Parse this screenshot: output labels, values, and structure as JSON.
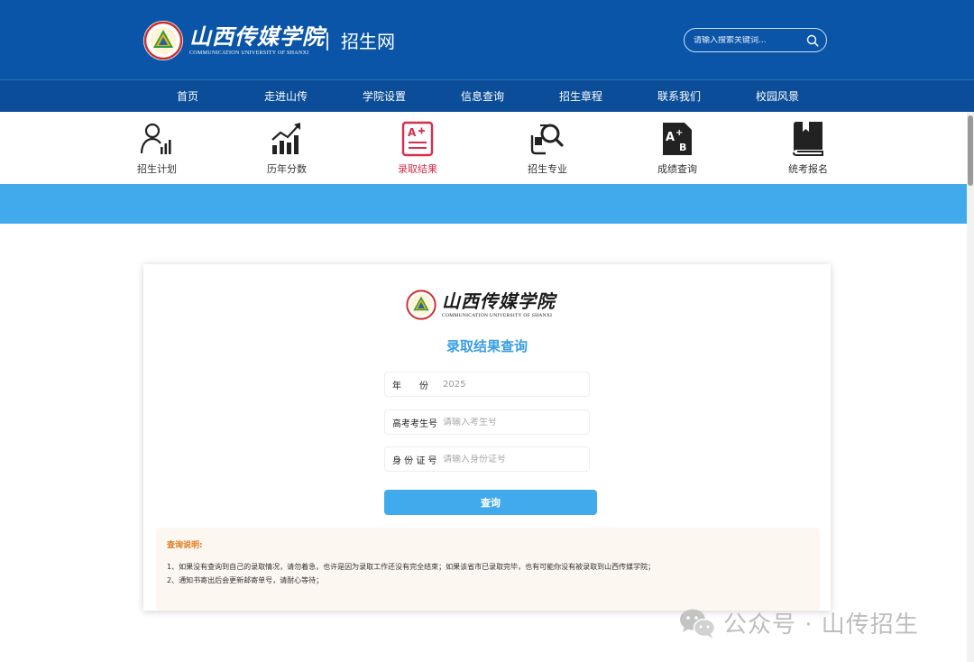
{
  "header": {
    "logo_cn": "山西传媒学院",
    "logo_en": "COMMUNICATION UNIVERSITY OF SHANXI",
    "site_name": "招生网",
    "search_placeholder": "请输入搜索关键词..."
  },
  "nav": {
    "items": [
      "首页",
      "走进山传",
      "学院设置",
      "信息查询",
      "招生章程",
      "联系我们",
      "校园风景"
    ]
  },
  "quick_links": {
    "items": [
      {
        "label": "招生计划",
        "icon": "person-chart-icon",
        "active": false
      },
      {
        "label": "历年分数",
        "icon": "trend-chart-icon",
        "active": false
      },
      {
        "label": "录取结果",
        "icon": "exam-result-icon",
        "active": true
      },
      {
        "label": "招生专业",
        "icon": "major-search-icon",
        "active": false
      },
      {
        "label": "成绩查询",
        "icon": "score-query-icon",
        "active": false
      },
      {
        "label": "统考报名",
        "icon": "book-icon",
        "active": false
      }
    ]
  },
  "card": {
    "logo_cn": "山西传媒学院",
    "logo_en": "COMMUNICATION UNIVERSITY OF SHANXI",
    "title": "录取结果查询",
    "fields": {
      "year": {
        "label": "年　　份",
        "value": "2025"
      },
      "exam_no": {
        "label": "高考考生号",
        "placeholder": "请输入考生号"
      },
      "id_no": {
        "label": "身 份 证 号",
        "placeholder": "请输入身份证号"
      }
    },
    "query_label": "查询",
    "notes": {
      "title": "查询说明:",
      "lines": [
        "1、如果没有查询到自己的录取情况，请勿着急，也许是因为录取工作还没有完全结束；如果该省市已录取完毕，也有可能你没有被录取到山西传媒学院；",
        "2、通知书寄出后会更新邮寄单号，请耐心等待；"
      ]
    }
  },
  "watermark": {
    "text": "公众号 · 山传招生"
  },
  "colors": {
    "header_blue": "#0a55a8",
    "nav_blue": "#0b4d99",
    "banner_blue": "#41aaec",
    "active_red": "#d72d4b",
    "title_blue": "#3b9ee2",
    "notes_title_orange": "#e07a1a"
  }
}
